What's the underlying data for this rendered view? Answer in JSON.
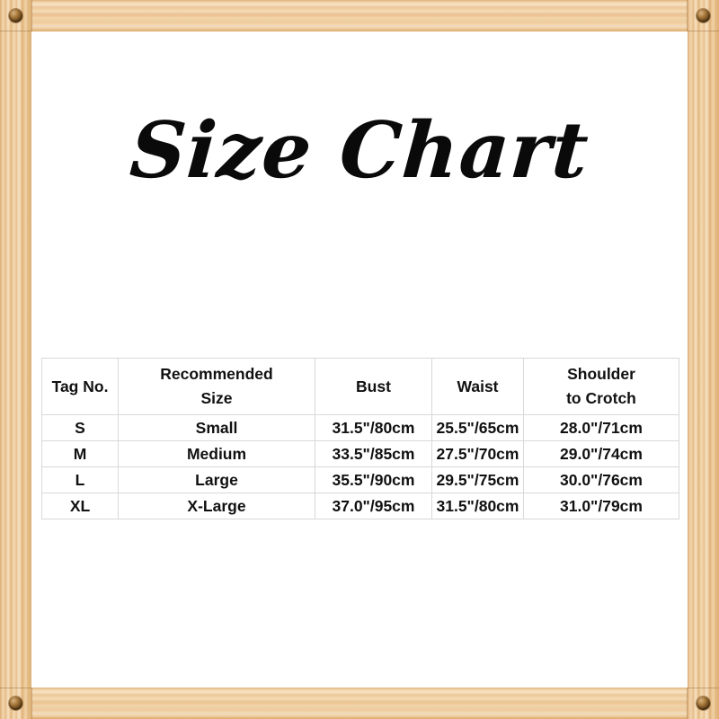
{
  "title": "Size Chart",
  "frame": {
    "material": "wood",
    "wood_color_light": "#f6e2c4",
    "wood_color_mid": "#edc695",
    "wood_color_dark": "#d9a868",
    "screw_color": "#6d4a1c",
    "screws": [
      "screw-top-left",
      "screw-top-right",
      "screw-bottom-left",
      "screw-bottom-right"
    ]
  },
  "table": {
    "headers": [
      {
        "lines": [
          "Tag No."
        ]
      },
      {
        "lines": [
          "Recommended",
          "Size"
        ]
      },
      {
        "lines": [
          "Bust"
        ]
      },
      {
        "lines": [
          "Waist"
        ]
      },
      {
        "lines": [
          "Shoulder",
          "to Crotch"
        ]
      }
    ],
    "rows": [
      {
        "tag_no": "S",
        "recommended_size": "Small",
        "bust": "31.5\"/80cm",
        "waist": "25.5\"/65cm",
        "shoulder_to_crotch": "28.0\"/71cm"
      },
      {
        "tag_no": "M",
        "recommended_size": "Medium",
        "bust": "33.5\"/85cm",
        "waist": "27.5\"/70cm",
        "shoulder_to_crotch": "29.0\"/74cm"
      },
      {
        "tag_no": "L",
        "recommended_size": "Large",
        "bust": "35.5\"/90cm",
        "waist": "29.5\"/75cm",
        "shoulder_to_crotch": "30.0\"/76cm"
      },
      {
        "tag_no": "XL",
        "recommended_size": "X-Large",
        "bust": "37.0\"/95cm",
        "waist": "31.5\"/80cm",
        "shoulder_to_crotch": "31.0\"/79cm"
      }
    ],
    "border_color": "#d8d8d8",
    "text_color": "#111111"
  }
}
